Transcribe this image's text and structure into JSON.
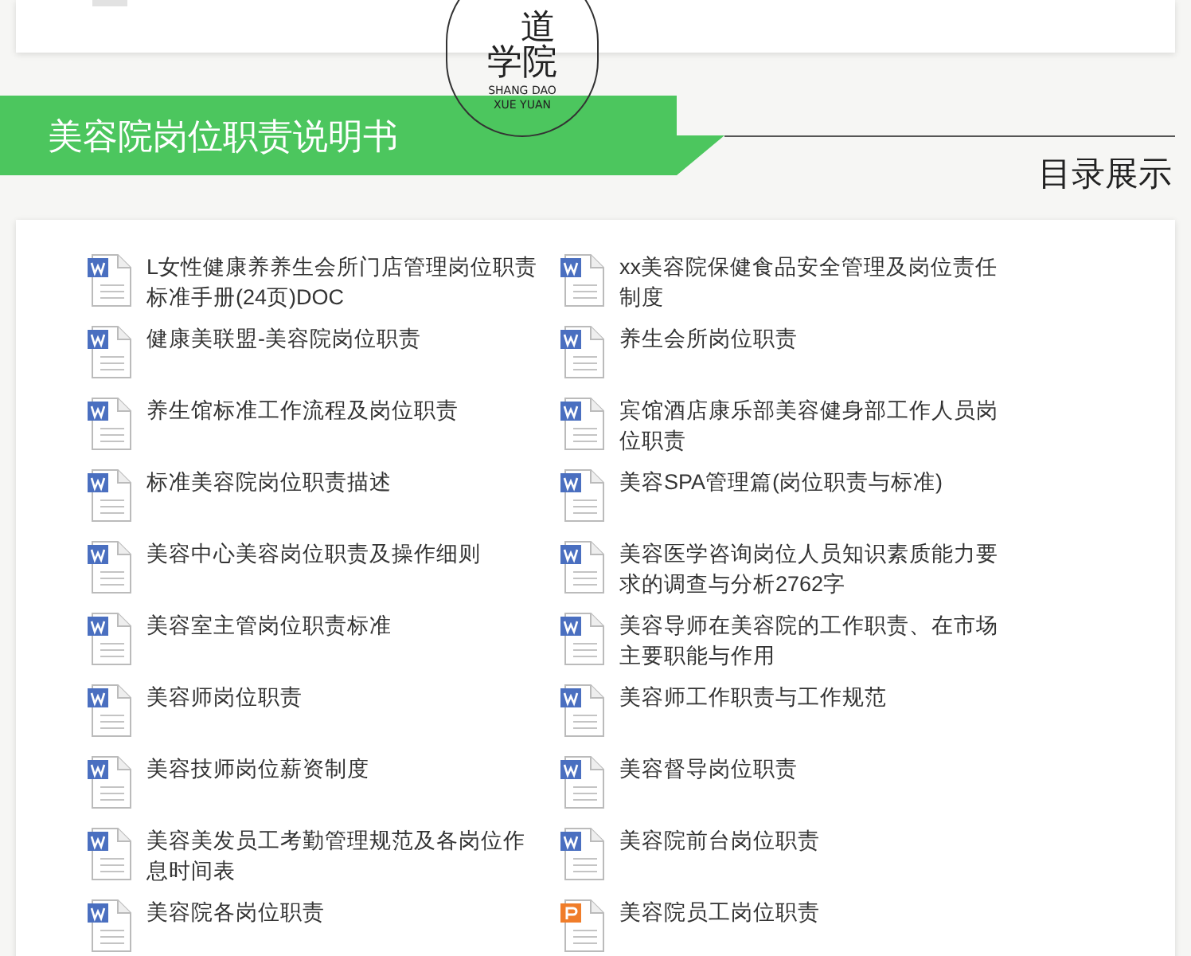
{
  "logo": {
    "mark_top": "道",
    "mark_bottom": "学院",
    "caption": [
      "SHANG DAO",
      "XUE YUAN"
    ]
  },
  "banner": {
    "title": "美容院岗位职责说明书"
  },
  "section_label": "目录展示",
  "files": [
    {
      "kind": "word",
      "name": "L女性健康养养生会所门店管理岗位职责标准手册(24页)DOC"
    },
    {
      "kind": "word",
      "name": "xx美容院保健食品安全管理及岗位责任制度"
    },
    {
      "kind": "word",
      "name": "健康美联盟-美容院岗位职责"
    },
    {
      "kind": "word",
      "name": "养生会所岗位职责"
    },
    {
      "kind": "word",
      "name": "养生馆标准工作流程及岗位职责"
    },
    {
      "kind": "word",
      "name": "宾馆酒店康乐部美容健身部工作人员岗位职责"
    },
    {
      "kind": "word",
      "name": "标准美容院岗位职责描述"
    },
    {
      "kind": "word",
      "name": "美容SPA管理篇(岗位职责与标准)"
    },
    {
      "kind": "word",
      "name": "美容中心美容岗位职责及操作细则"
    },
    {
      "kind": "word",
      "name": "美容医学咨询岗位人员知识素质能力要求的调查与分析2762字"
    },
    {
      "kind": "word",
      "name": "美容室主管岗位职责标准"
    },
    {
      "kind": "word",
      "name": "美容导师在美容院的工作职责、在市场主要职能与作用"
    },
    {
      "kind": "word",
      "name": "美容师岗位职责"
    },
    {
      "kind": "word",
      "name": "美容师工作职责与工作规范"
    },
    {
      "kind": "word",
      "name": "美容技师岗位薪资制度"
    },
    {
      "kind": "word",
      "name": "美容督导岗位职责"
    },
    {
      "kind": "word",
      "name": "美容美发员工考勤管理规范及各岗位作息时间表"
    },
    {
      "kind": "word",
      "name": "美容院前台岗位职责"
    },
    {
      "kind": "word",
      "name": "美容院各岗位职责"
    },
    {
      "kind": "ppt",
      "name": "美容院员工岗位职责"
    }
  ]
}
